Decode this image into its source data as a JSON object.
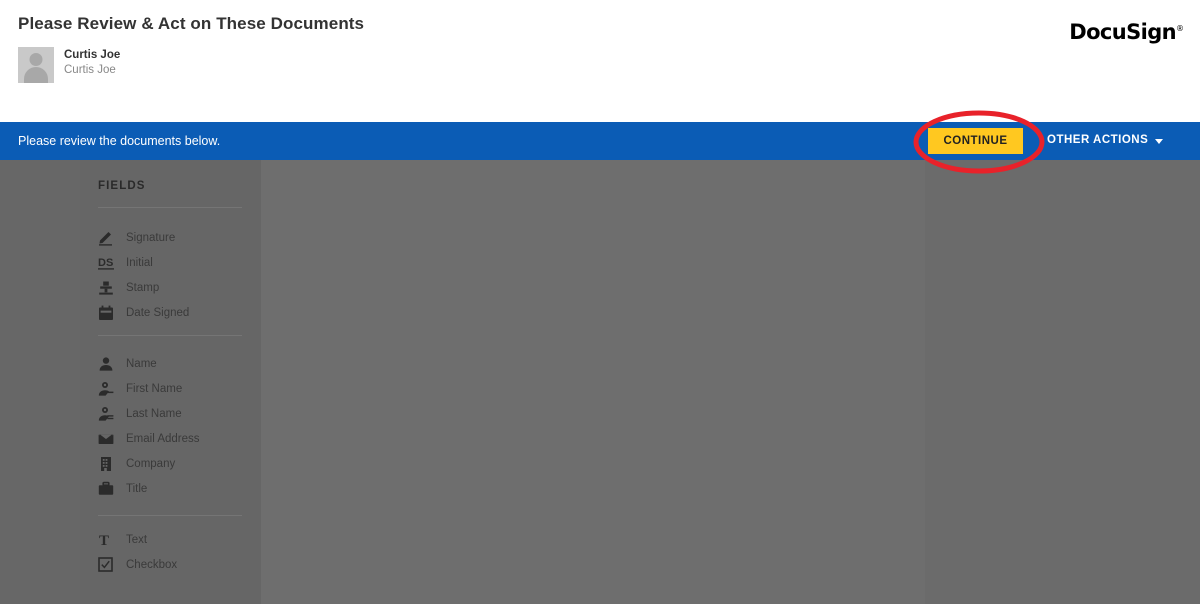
{
  "header": {
    "title": "Please Review & Act on These Documents",
    "recipient": {
      "name": "Curtis Joe",
      "subtitle": "Curtis Joe",
      "avatar_icon": "user-placeholder-icon"
    },
    "logo": {
      "text": "DocuSign",
      "trademark": "®"
    }
  },
  "action_bar": {
    "message": "Please review the documents below.",
    "continue_label": "CONTINUE",
    "other_actions_label": "OTHER ACTIONS",
    "other_actions_icon": "chevron-down-icon",
    "bar_color": "#0b5cb5",
    "continue_color": "#ffc820"
  },
  "sidebar": {
    "title": "FIELDS",
    "groups": [
      {
        "items": [
          {
            "label": "Signature",
            "icon": "signature-pen-icon"
          },
          {
            "label": "Initial",
            "icon": "ds-initial-icon"
          },
          {
            "label": "Stamp",
            "icon": "stamp-icon"
          },
          {
            "label": "Date Signed",
            "icon": "calendar-icon"
          }
        ]
      },
      {
        "items": [
          {
            "label": "Name",
            "icon": "person-icon"
          },
          {
            "label": "First Name",
            "icon": "person-first-name-icon"
          },
          {
            "label": "Last Name",
            "icon": "person-last-name-icon"
          },
          {
            "label": "Email Address",
            "icon": "envelope-icon"
          },
          {
            "label": "Company",
            "icon": "building-icon"
          },
          {
            "label": "Title",
            "icon": "briefcase-icon"
          }
        ]
      },
      {
        "items": [
          {
            "label": "Text",
            "icon": "text-t-icon"
          },
          {
            "label": "Checkbox",
            "icon": "checkbox-icon"
          }
        ]
      }
    ]
  },
  "annotation": {
    "shape": "ellipse",
    "color": "#e8222a",
    "target": "CONTINUE"
  },
  "document_area": {
    "background": "#6e6e6e",
    "content": ""
  }
}
